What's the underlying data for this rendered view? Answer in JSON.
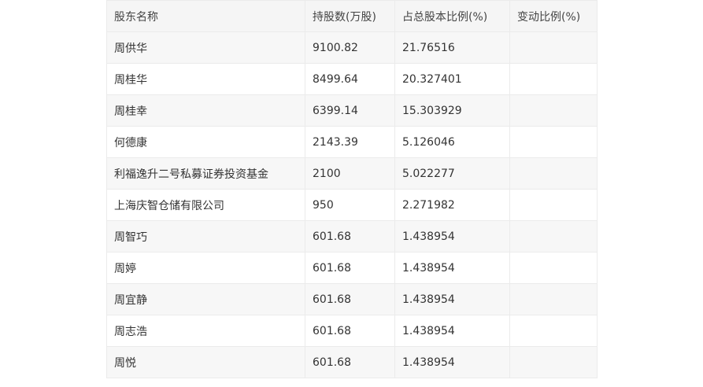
{
  "table": {
    "headers": [
      "股东名称",
      "持股数(万股)",
      "占总股本比例(%)",
      "变动比例(%)"
    ],
    "rows": [
      [
        "周供华",
        "9100.82",
        "21.76516",
        ""
      ],
      [
        "周桂华",
        "8499.64",
        "20.327401",
        ""
      ],
      [
        "周桂幸",
        "6399.14",
        "15.303929",
        ""
      ],
      [
        "何德康",
        "2143.39",
        "5.126046",
        ""
      ],
      [
        "利福逸升二号私募证券投资基金",
        "2100",
        "5.022277",
        ""
      ],
      [
        "上海庆智仓储有限公司",
        "950",
        "2.271982",
        ""
      ],
      [
        "周智巧",
        "601.68",
        "1.438954",
        ""
      ],
      [
        "周婷",
        "601.68",
        "1.438954",
        ""
      ],
      [
        "周宜静",
        "601.68",
        "1.438954",
        ""
      ],
      [
        "周志浩",
        "601.68",
        "1.438954",
        ""
      ],
      [
        "周悦",
        "601.68",
        "1.438954",
        ""
      ]
    ]
  }
}
